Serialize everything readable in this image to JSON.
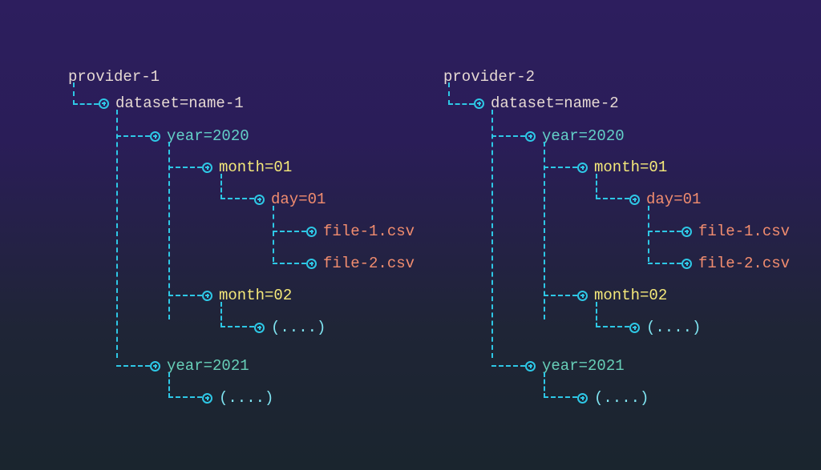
{
  "trees": [
    {
      "root": "provider-1",
      "dataset": "dataset=name-1",
      "years": [
        {
          "label": "year=2020",
          "months": [
            {
              "label": "month=01",
              "days": [
                {
                  "label": "day=01",
                  "files": [
                    "file-1.csv",
                    "file-2.csv"
                  ]
                }
              ]
            },
            {
              "label": "month=02",
              "ellipsis": "(....)"
            }
          ]
        },
        {
          "label": "year=2021",
          "ellipsis": "(....)"
        }
      ]
    },
    {
      "root": "provider-2",
      "dataset": "dataset=name-2",
      "years": [
        {
          "label": "year=2020",
          "months": [
            {
              "label": "month=01",
              "days": [
                {
                  "label": "day=01",
                  "files": [
                    "file-1.csv",
                    "file-2.csv"
                  ]
                }
              ]
            },
            {
              "label": "month=02",
              "ellipsis": "(....)"
            }
          ]
        },
        {
          "label": "year=2021",
          "ellipsis": "(....)"
        }
      ]
    }
  ]
}
